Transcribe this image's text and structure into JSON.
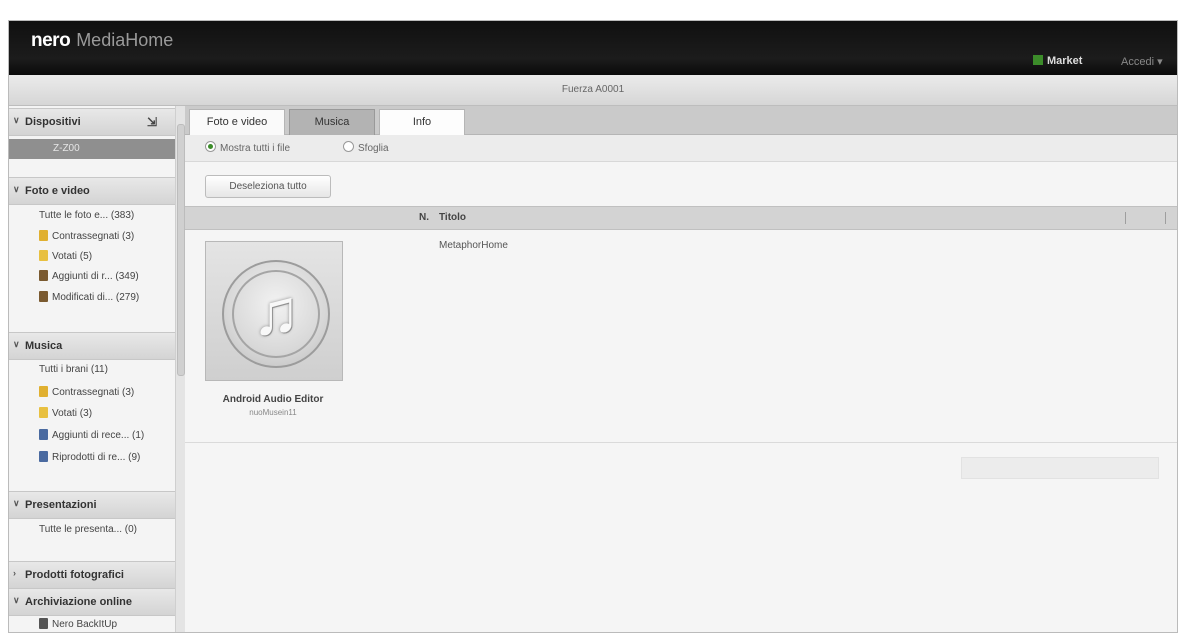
{
  "app": {
    "brand": "nero",
    "product": "MediaHome"
  },
  "topbar": {
    "market_label": "Market",
    "user_label": "Accedi"
  },
  "device_title": "Fuerza A0001",
  "sidebar": {
    "dispositivi": {
      "label": "Dispositivi",
      "device": "Z-Z00"
    },
    "foto_video": {
      "label": "Foto e video",
      "items": [
        {
          "label": "Tutte le foto e... (383)",
          "icon": "none"
        },
        {
          "label": "Contrassegnati (3)",
          "icon": "flag",
          "color": "#e0b030"
        },
        {
          "label": "Votati (5)",
          "icon": "star",
          "color": "#e8c040"
        },
        {
          "label": "Aggiunti di r... (349)",
          "icon": "folder",
          "color": "#7a5a30"
        },
        {
          "label": "Modificati di... (279)",
          "icon": "folder",
          "color": "#7a5a30"
        }
      ]
    },
    "musica": {
      "label": "Musica",
      "items": [
        {
          "label": "Tutti i brani (11)",
          "icon": "none"
        },
        {
          "label": "Contrassegnati (3)",
          "icon": "flag",
          "color": "#e0b030"
        },
        {
          "label": "Votati (3)",
          "icon": "star",
          "color": "#e8c040"
        },
        {
          "label": "Aggiunti di rece... (1)",
          "icon": "note",
          "color": "#4a6aa0"
        },
        {
          "label": "Riprodotti di re... (9)",
          "icon": "note",
          "color": "#4a6aa0"
        }
      ]
    },
    "presentazioni": {
      "label": "Presentazioni",
      "items": [
        {
          "label": "Tutte le presenta... (0)"
        }
      ]
    },
    "prodotti": {
      "label": "Prodotti fotografici"
    },
    "archiviazione": {
      "label": "Archiviazione online",
      "items": [
        {
          "label": "Nero BackItUp"
        }
      ]
    }
  },
  "tabs": [
    {
      "label": "Foto e video"
    },
    {
      "label": "Musica"
    },
    {
      "label": "Info"
    }
  ],
  "filter": {
    "show_all": "Mostra tutti i file",
    "select": "Sfoglia"
  },
  "deselect_button": "Deseleziona tutto",
  "columns": {
    "n": "N.",
    "title": "Titolo"
  },
  "file": {
    "name": "Android Audio Editor",
    "sub": "nuoMusein11",
    "list_title": "MetaphorHome"
  }
}
